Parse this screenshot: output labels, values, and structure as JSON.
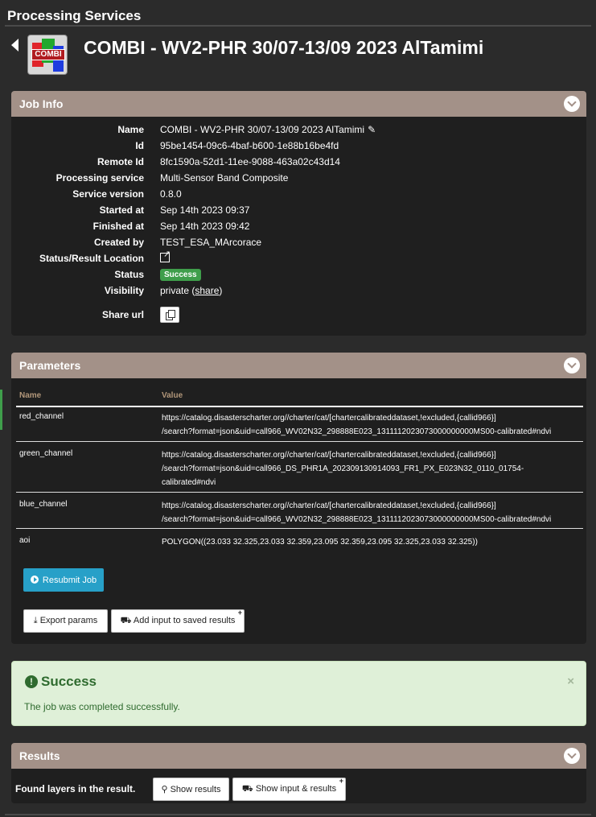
{
  "page": {
    "header_title": "Processing Services"
  },
  "job": {
    "title": "COMBI - WV2-PHR 30/07-13/09 2023 AlTamimi",
    "logo_text": "COMBI"
  },
  "job_info": {
    "panel_title": "Job Info",
    "fields": {
      "name_label": "Name",
      "name_value": "COMBI - WV2-PHR 30/07-13/09 2023 AlTamimi",
      "id_label": "Id",
      "id_value": "95be1454-09c6-4baf-b600-1e88b16be4fd",
      "remote_id_label": "Remote Id",
      "remote_id_value": "8fc1590a-52d1-11ee-9088-463a02c43d14",
      "service_label": "Processing service",
      "service_value": "Multi-Sensor Band Composite",
      "version_label": "Service version",
      "version_value": "0.8.0",
      "started_label": "Started at",
      "started_value": "Sep 14th 2023 09:37",
      "finished_label": "Finished at",
      "finished_value": "Sep 14th 2023 09:42",
      "created_label": "Created by",
      "created_value": "TEST_ESA_MArcorace",
      "location_label": "Status/Result Location",
      "status_label": "Status",
      "status_value": "Success",
      "visibility_label": "Visibility",
      "visibility_value": "private",
      "visibility_share": "share",
      "share_url_label": "Share url"
    }
  },
  "parameters": {
    "panel_title": "Parameters",
    "col_name": "Name",
    "col_value": "Value",
    "rows": [
      {
        "name": "red_channel",
        "value_line1": "https://catalog.disasterscharter.org//charter/cat/[chartercalibrateddataset,!excluded,{callid966}]",
        "value_line2": "/search?format=json&uid=call966_WV02N32_298888E023_1311112023073000000000MS00-calibrated#ndvi"
      },
      {
        "name": "green_channel",
        "value_line1": "https://catalog.disasterscharter.org//charter/cat/[chartercalibrateddataset,!excluded,{callid966}]",
        "value_line2": "/search?format=json&uid=call966_DS_PHR1A_202309130914093_FR1_PX_E023N32_0110_01754-",
        "value_line3": "calibrated#ndvi"
      },
      {
        "name": "blue_channel",
        "value_line1": "https://catalog.disasterscharter.org//charter/cat/[chartercalibrateddataset,!excluded,{callid966}]",
        "value_line2": "/search?format=json&uid=call966_WV02N32_298888E023_1311112023073000000000MS00-calibrated#ndvi"
      },
      {
        "name": "aoi",
        "value_line1": "POLYGON((23.033 32.325,23.033 32.359,23.095 32.359,23.095 32.325,23.033 32.325))"
      }
    ],
    "resubmit_label": "Resubmit Job",
    "export_label": "Export params",
    "add_input_label": "Add input to saved results"
  },
  "alert": {
    "title": "Success",
    "message": "The job was completed successfully.",
    "close": "×"
  },
  "results": {
    "panel_title": "Results",
    "found_text": "Found layers in the result.",
    "show_results_label": "Show results",
    "show_input_results_label": "Show input & results"
  },
  "colors": {
    "panel_header": "#a39188",
    "success_badge": "#3f9e4b",
    "resubmit_button": "#27a0c8",
    "alert_bg": "#dff0d8"
  }
}
